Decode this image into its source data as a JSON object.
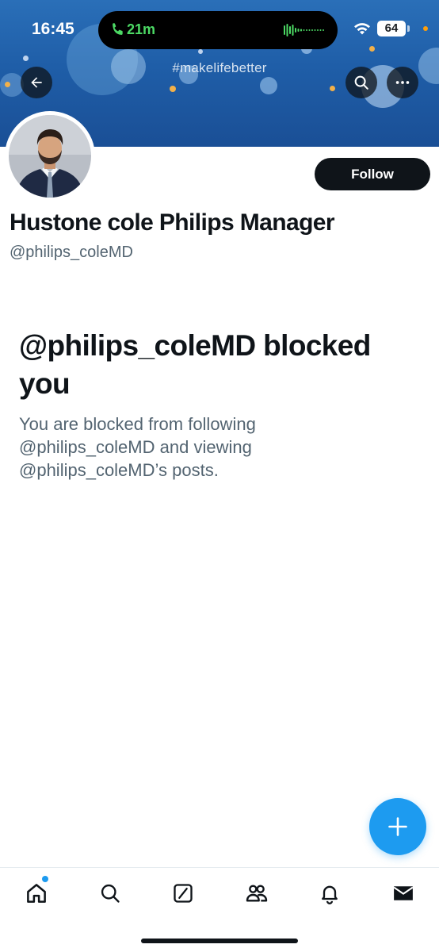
{
  "status_bar": {
    "time": "16:45",
    "call_duration": "21m",
    "battery_level": "64",
    "icons": [
      "phone-icon",
      "waveform-icon",
      "wifi-icon",
      "battery-icon"
    ]
  },
  "banner": {
    "hashtag": "#makelifebetter"
  },
  "header": {
    "icons": [
      "back-arrow-icon",
      "search-icon",
      "more-icon"
    ]
  },
  "profile": {
    "display_name": "Hustone cole Philips Manager",
    "handle": "@philips_coleMD",
    "follow_label": "Follow"
  },
  "blocked": {
    "title": "@philips_coleMD blocked you",
    "description": "You are blocked from following @philips_coleMD and viewing @philips_coleMD’s posts."
  },
  "fab": {
    "icon": "plus-icon"
  },
  "tab_bar": {
    "tabs": [
      {
        "name": "home",
        "icon": "home-icon"
      },
      {
        "name": "search",
        "icon": "search-icon"
      },
      {
        "name": "grok",
        "icon": "slash-box-icon"
      },
      {
        "name": "communities",
        "icon": "people-icon"
      },
      {
        "name": "notifications",
        "icon": "bell-icon"
      },
      {
        "name": "messages",
        "icon": "envelope-icon"
      }
    ]
  },
  "colors": {
    "accent": "#1d9bf0",
    "text_primary": "#0f1419",
    "text_secondary": "#536471",
    "banner_blue": "#1f5ea8",
    "call_green": "#4cd964"
  }
}
